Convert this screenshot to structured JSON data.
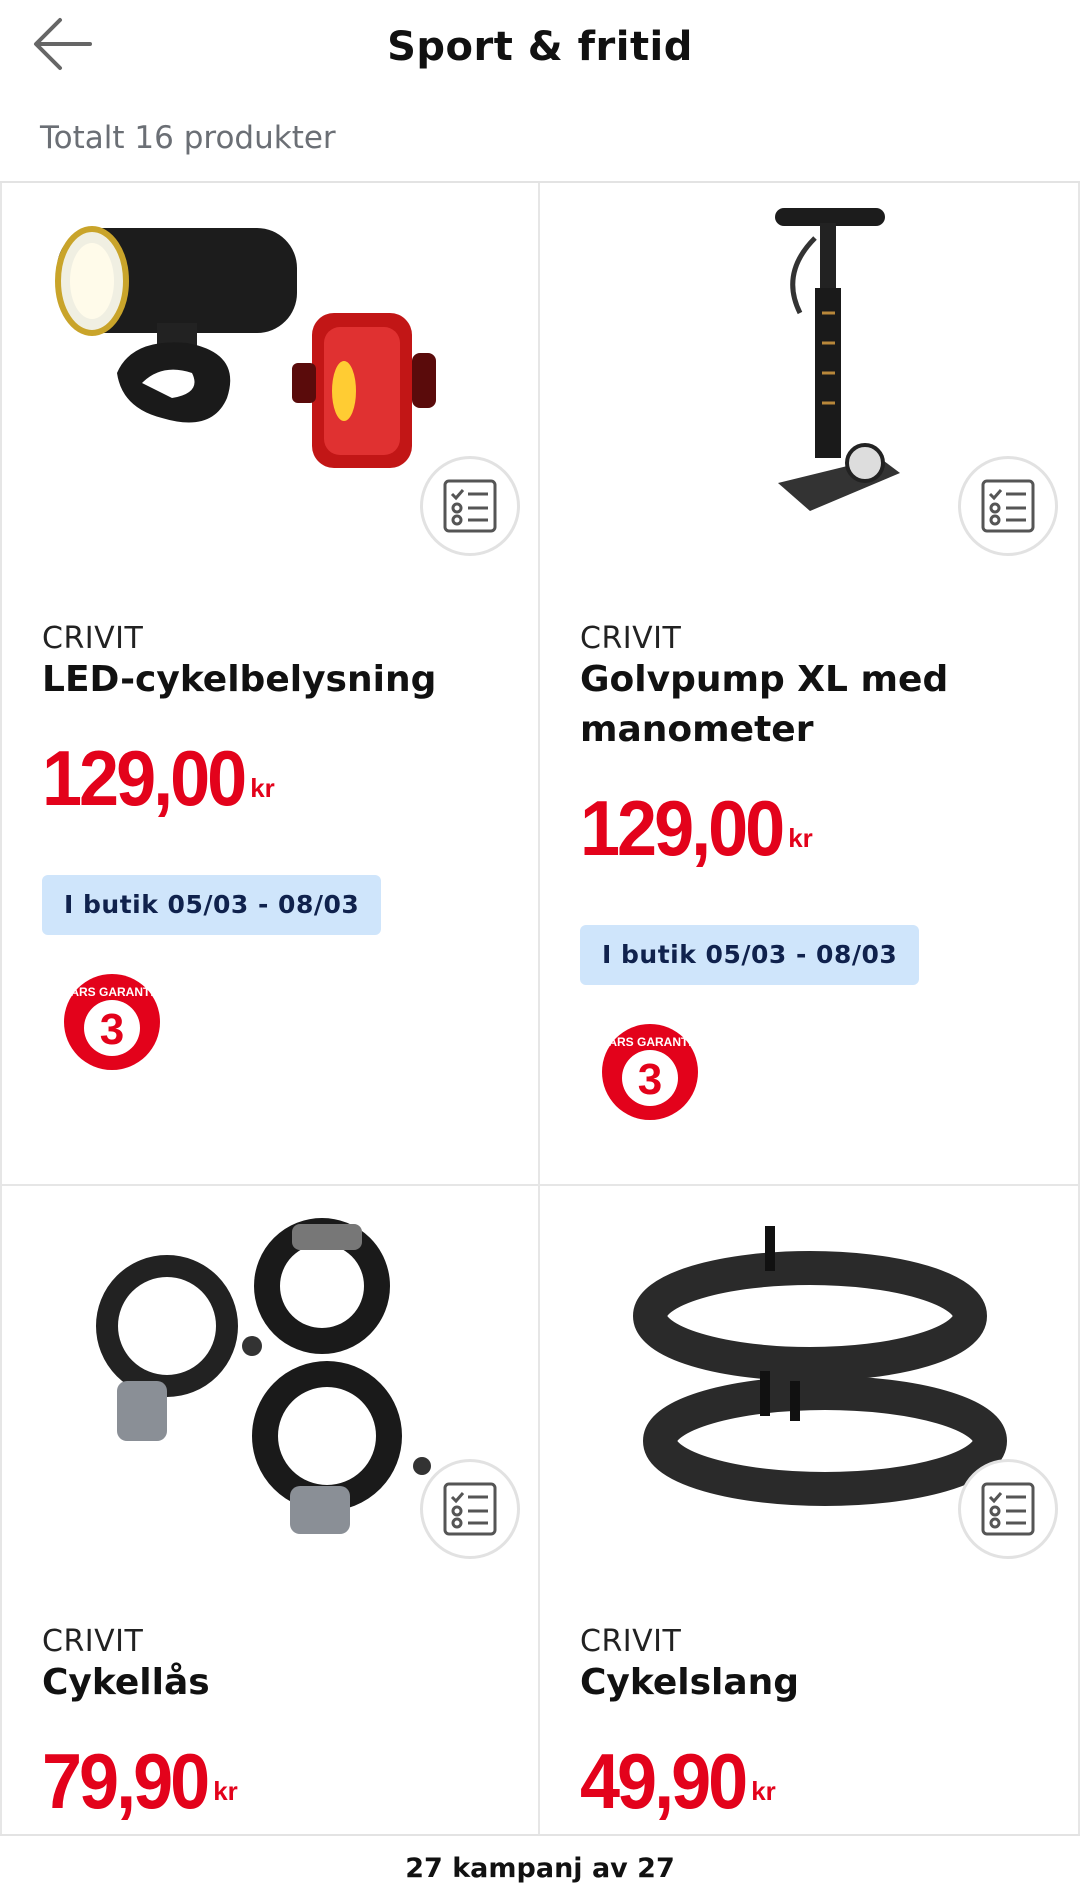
{
  "header": {
    "title": "Sport & fritid",
    "back_icon": "arrow-left-icon"
  },
  "summary": {
    "count_text": "Totalt 16 produkter"
  },
  "products": [
    {
      "brand": "CRIVIT",
      "name": "LED-cykelbelysning",
      "price_main": "129,00",
      "currency": "kr",
      "availability": "I butik 05/03 - 08/03",
      "guarantee": "3",
      "guarantee_label": "ÅRS GARANTI"
    },
    {
      "brand": "CRIVIT",
      "name": "Golvpump XL med manometer",
      "price_main": "129,00",
      "currency": "kr",
      "availability": "I butik 05/03 - 08/03",
      "guarantee": "3",
      "guarantee_label": "ÅRS GARANTI"
    },
    {
      "brand": "CRIVIT",
      "name": "Cykellås",
      "price_main": "79,90",
      "currency": "kr"
    },
    {
      "brand": "CRIVIT",
      "name": "Cykelslang",
      "price_main": "49,90",
      "currency": "kr"
    }
  ],
  "footer": {
    "text": "27 kampanj av 27"
  },
  "colors": {
    "price": "#e3021b",
    "badge_bg": "#cfe5fb",
    "badge_text": "#10224d"
  }
}
